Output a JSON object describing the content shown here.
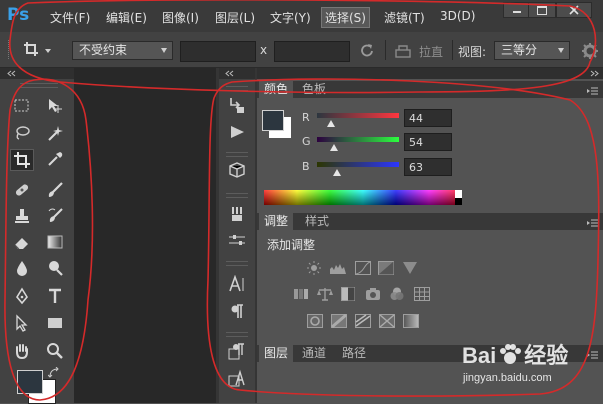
{
  "app": {
    "logo": "Ps"
  },
  "menu": {
    "items": [
      "文件(F)",
      "编辑(E)",
      "图像(I)",
      "图层(L)",
      "文字(Y)",
      "选择(S)",
      "滤镜(T)",
      "3D(D)"
    ],
    "selected_index": 5
  },
  "options": {
    "style_value": "不受约束",
    "x_label": "x",
    "straighten_label": "拉直",
    "view_label": "视图:",
    "view_value": "三等分"
  },
  "color_panel": {
    "tabs": [
      "颜色",
      "色板"
    ],
    "active_tab": 0,
    "channels": [
      {
        "label": "R",
        "value": "44"
      },
      {
        "label": "G",
        "value": "54"
      },
      {
        "label": "B",
        "value": "63"
      }
    ],
    "foreground_color": "#2c363f",
    "background_color": "#ffffff"
  },
  "adjust_panel": {
    "tabs": [
      "调整",
      "样式"
    ],
    "active_tab": 0,
    "title": "添加调整"
  },
  "layers_panel": {
    "tabs": [
      "图层",
      "通道",
      "路径"
    ],
    "active_tab": 0
  },
  "watermark": {
    "brand_prefix": "Bai",
    "brand_suffix": "经验",
    "url": "jingyan.baidu.com"
  },
  "annotation_color": "#d42a2a"
}
